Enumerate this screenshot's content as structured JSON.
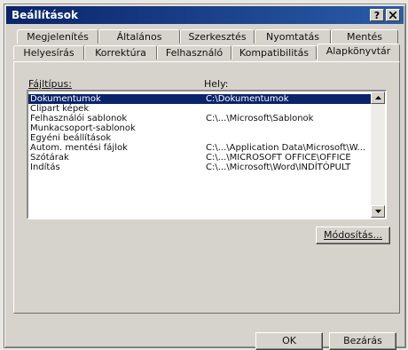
{
  "window": {
    "title": "Beállítások",
    "help_label": "?",
    "close_label": "x"
  },
  "tabs_back": [
    {
      "label": "Megjelenítés"
    },
    {
      "label": "Általános"
    },
    {
      "label": "Szerkesztés"
    },
    {
      "label": "Nyomtatás"
    },
    {
      "label": "Mentés"
    }
  ],
  "tabs_front": [
    {
      "label": "Helyesírás"
    },
    {
      "label": "Korrektúra"
    },
    {
      "label": "Felhasználó"
    },
    {
      "label": "Kompatibilitás"
    },
    {
      "label": "Alapkönyvtár",
      "active": true
    }
  ],
  "columns": {
    "type_label": "Fájltípus:",
    "location_label": "Hely:"
  },
  "rows": [
    {
      "type": "Dokumentumok",
      "location": "C:\\Dokumentumok",
      "selected": true
    },
    {
      "type": "Clipart képek",
      "location": ""
    },
    {
      "type": "Felhasználói sablonok",
      "location": "C:\\...\\Microsoft\\Sablonok"
    },
    {
      "type": "Munkacsoport-sablonok",
      "location": ""
    },
    {
      "type": "Egyéni beállítások",
      "location": ""
    },
    {
      "type": "Autom. mentési fájlok",
      "location": "C:\\...\\Application Data\\Microsoft\\W..."
    },
    {
      "type": "Szótárak",
      "location": "C:\\...\\MICROSOFT OFFICE\\OFFICE"
    },
    {
      "type": "Indítás",
      "location": "C:\\...\\Microsoft\\Word\\INDÍTÓPULT"
    }
  ],
  "scroll": {
    "up_icon": "arrow-up-icon",
    "down_icon": "arrow-down-icon"
  },
  "buttons": {
    "modify_label": "Módosítás...",
    "ok_label": "OK",
    "cancel_label": "Bezárás"
  },
  "colors": {
    "title_bar": "#0a246a",
    "selection": "#0a246a",
    "face": "#d6d3cc"
  }
}
